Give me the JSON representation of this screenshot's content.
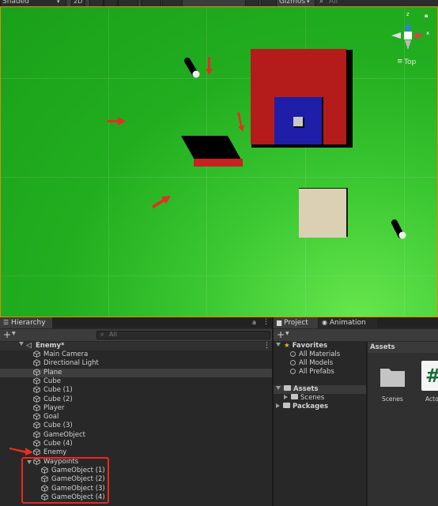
{
  "toolbar": {
    "shading_mode": "Shaded",
    "mode_2d": "2D",
    "gizmos_label": "Gizmos",
    "search_placeholder": "All"
  },
  "scene": {
    "view_orientation": "Top",
    "axis_labels": {
      "y": "y",
      "z": "z",
      "x": "x"
    }
  },
  "hierarchy": {
    "tab_label": "Hierarchy",
    "add_label": "+",
    "search_placeholder": "All",
    "scene_name": "Enemy*",
    "items": [
      "Main Camera",
      "Directional Light",
      "Plane",
      "Cube",
      "Cube (1)",
      "Cube (2)",
      "Player",
      "Goal",
      "Cube (3)",
      "GameObject",
      "Cube (4)",
      "Enemy"
    ],
    "waypoints_label": "Waypoints",
    "waypoint_children": [
      "GameObject (1)",
      "GameObject (2)",
      "GameObject (3)",
      "GameObject (4)"
    ],
    "selected_item": "Plane"
  },
  "project": {
    "tab_label": "Project",
    "animation_tab_label": "Animation",
    "add_label": "+",
    "favorites_label": "Favorites",
    "favorites_items": [
      "All Materials",
      "All Models",
      "All Prefabs"
    ],
    "assets_label": "Assets",
    "assets_children": [
      "Scenes"
    ],
    "packages_label": "Packages",
    "assets_header": "Assets",
    "asset_tiles": [
      {
        "label": "Scenes",
        "icon": "folder-icon"
      },
      {
        "label": "Acto",
        "icon": "csharp-script-icon",
        "glyph": "#"
      }
    ]
  },
  "colors": {
    "scene_border": "#e58a00",
    "ground": "#22ad1f",
    "red_box": "#b41c1c",
    "blue_box": "#1e1ea8",
    "beige_box": "#dcd0b4",
    "annotation_red": "#e23020"
  }
}
